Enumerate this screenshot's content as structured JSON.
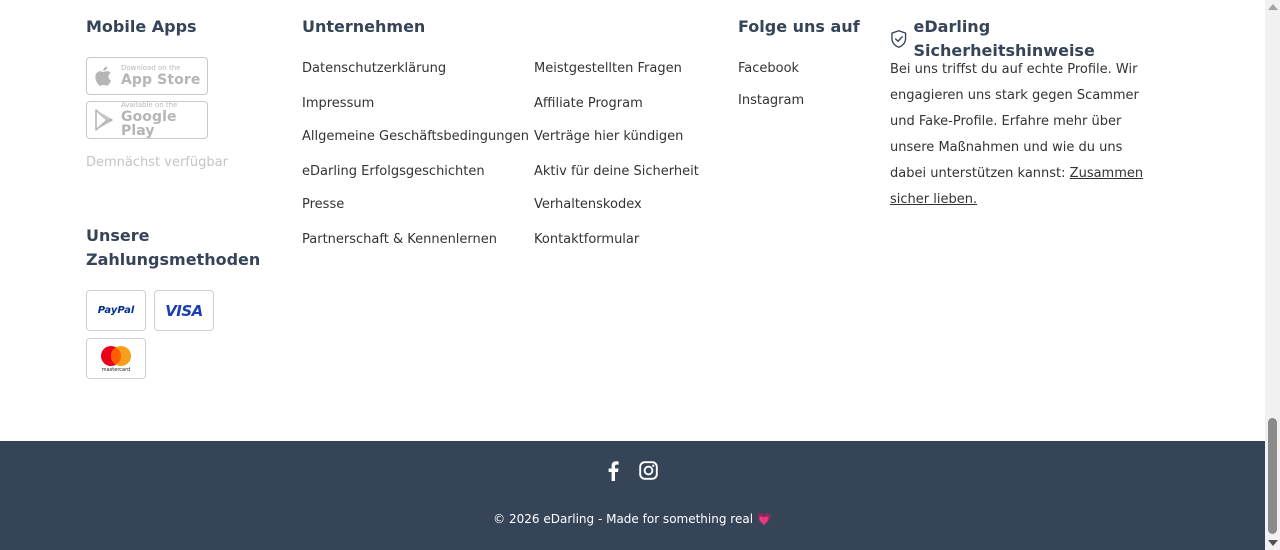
{
  "mobile_apps": {
    "heading": "Mobile Apps",
    "app_store_small": "Download on the",
    "app_store_big": "App Store",
    "google_play_small": "Available on the",
    "google_play_big": "Google Play",
    "coming_soon": "Demnächst verfügbar"
  },
  "payments": {
    "heading_line1": "Unsere",
    "heading_line2": "Zahlungsmethoden",
    "paypal": "PayPal",
    "visa": "VISA",
    "mastercard": "mastercard"
  },
  "company": {
    "heading": "Unternehmen",
    "links_col1": [
      "Datenschutzerklärung",
      "Impressum",
      "Allgemeine Geschäftsbedingungen",
      "eDarling Erfolgsgeschichten",
      "Presse",
      "Partnerschaft & Kennenlernen"
    ],
    "links_col2": [
      "Meistgestellten Fragen",
      "Affiliate Program",
      "Verträge hier kündigen",
      "Aktiv für deine Sicherheit",
      "Verhaltenskodex",
      "Kontaktformular"
    ]
  },
  "follow": {
    "heading": "Folge uns auf",
    "links": [
      "Facebook",
      "Instagram"
    ]
  },
  "safety": {
    "heading": "eDarling Sicherheitshinweise",
    "text": "Bei uns triffst du auf echte Profile. Wir engagieren uns stark gegen Scammer und Fake-Profile. Erfahre mehr über unsere Maßnahmen und wie du uns dabei unterstützen kannst: ",
    "link": "Zusammen sicher lieben."
  },
  "bottom": {
    "copyright": "© 2026 eDarling - Made for something real",
    "heart": "💗"
  },
  "colors": {
    "heading": "#364458",
    "footer_bar": "#364458",
    "heart": "#e8336f"
  }
}
